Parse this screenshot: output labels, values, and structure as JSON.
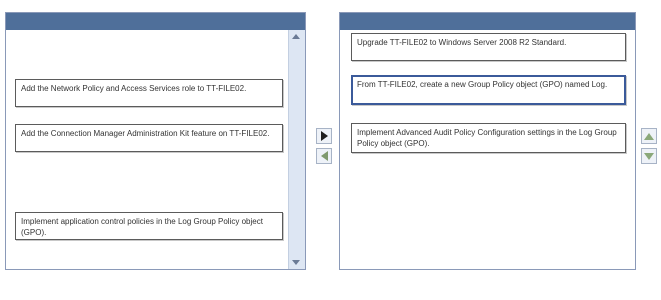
{
  "left_panel": {
    "items": [
      {
        "label": "Add the Network Policy and Access Services role to TT-FILE02."
      },
      {
        "label": "Add the Connection Manager Administration Kit feature on TT-FILE02."
      },
      {
        "label": "Implement application control policies in the Log Group Policy object (GPO)."
      }
    ]
  },
  "right_panel": {
    "items": [
      {
        "label": "Upgrade TT-FILE02 to Windows Server 2008 R2 Standard."
      },
      {
        "label": "From TT-FILE02, create a new Group Policy object (GPO) named Log."
      },
      {
        "label": "Implement Advanced Audit Policy Configuration settings in the Log Group Policy object (GPO)."
      }
    ]
  },
  "controls": {
    "move_right_icon": "arrow-right-icon",
    "move_left_icon": "arrow-left-icon",
    "move_up_icon": "arrow-up-icon",
    "move_down_icon": "arrow-down-icon"
  },
  "colors": {
    "header": "#4f6f9a",
    "selected_border": "#3b5a9a",
    "scroll_track": "#dde6f3"
  }
}
